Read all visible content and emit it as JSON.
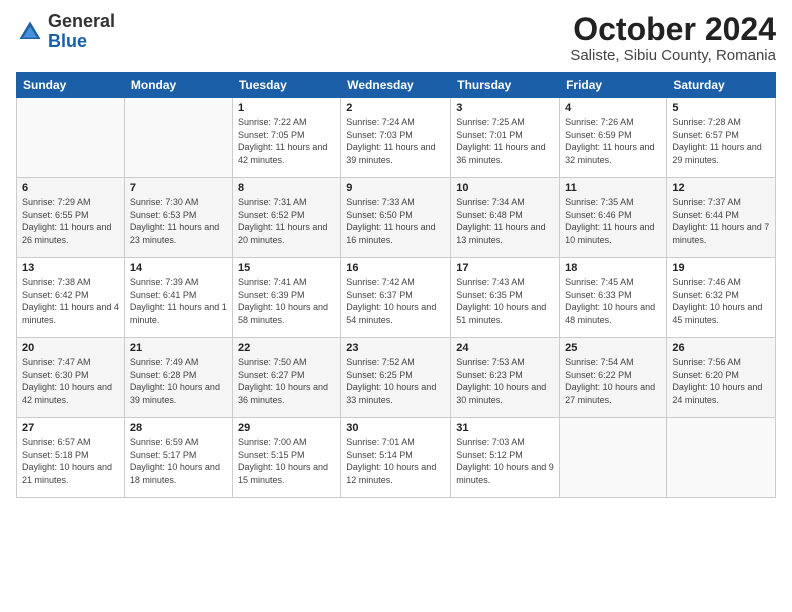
{
  "header": {
    "logo_general": "General",
    "logo_blue": "Blue",
    "month_title": "October 2024",
    "location": "Saliste, Sibiu County, Romania"
  },
  "days_of_week": [
    "Sunday",
    "Monday",
    "Tuesday",
    "Wednesday",
    "Thursday",
    "Friday",
    "Saturday"
  ],
  "weeks": [
    [
      {
        "day": "",
        "info": ""
      },
      {
        "day": "",
        "info": ""
      },
      {
        "day": "1",
        "info": "Sunrise: 7:22 AM\nSunset: 7:05 PM\nDaylight: 11 hours\nand 42 minutes."
      },
      {
        "day": "2",
        "info": "Sunrise: 7:24 AM\nSunset: 7:03 PM\nDaylight: 11 hours\nand 39 minutes."
      },
      {
        "day": "3",
        "info": "Sunrise: 7:25 AM\nSunset: 7:01 PM\nDaylight: 11 hours\nand 36 minutes."
      },
      {
        "day": "4",
        "info": "Sunrise: 7:26 AM\nSunset: 6:59 PM\nDaylight: 11 hours\nand 32 minutes."
      },
      {
        "day": "5",
        "info": "Sunrise: 7:28 AM\nSunset: 6:57 PM\nDaylight: 11 hours\nand 29 minutes."
      }
    ],
    [
      {
        "day": "6",
        "info": "Sunrise: 7:29 AM\nSunset: 6:55 PM\nDaylight: 11 hours\nand 26 minutes."
      },
      {
        "day": "7",
        "info": "Sunrise: 7:30 AM\nSunset: 6:53 PM\nDaylight: 11 hours\nand 23 minutes."
      },
      {
        "day": "8",
        "info": "Sunrise: 7:31 AM\nSunset: 6:52 PM\nDaylight: 11 hours\nand 20 minutes."
      },
      {
        "day": "9",
        "info": "Sunrise: 7:33 AM\nSunset: 6:50 PM\nDaylight: 11 hours\nand 16 minutes."
      },
      {
        "day": "10",
        "info": "Sunrise: 7:34 AM\nSunset: 6:48 PM\nDaylight: 11 hours\nand 13 minutes."
      },
      {
        "day": "11",
        "info": "Sunrise: 7:35 AM\nSunset: 6:46 PM\nDaylight: 11 hours\nand 10 minutes."
      },
      {
        "day": "12",
        "info": "Sunrise: 7:37 AM\nSunset: 6:44 PM\nDaylight: 11 hours\nand 7 minutes."
      }
    ],
    [
      {
        "day": "13",
        "info": "Sunrise: 7:38 AM\nSunset: 6:42 PM\nDaylight: 11 hours\nand 4 minutes."
      },
      {
        "day": "14",
        "info": "Sunrise: 7:39 AM\nSunset: 6:41 PM\nDaylight: 11 hours\nand 1 minute."
      },
      {
        "day": "15",
        "info": "Sunrise: 7:41 AM\nSunset: 6:39 PM\nDaylight: 10 hours\nand 58 minutes."
      },
      {
        "day": "16",
        "info": "Sunrise: 7:42 AM\nSunset: 6:37 PM\nDaylight: 10 hours\nand 54 minutes."
      },
      {
        "day": "17",
        "info": "Sunrise: 7:43 AM\nSunset: 6:35 PM\nDaylight: 10 hours\nand 51 minutes."
      },
      {
        "day": "18",
        "info": "Sunrise: 7:45 AM\nSunset: 6:33 PM\nDaylight: 10 hours\nand 48 minutes."
      },
      {
        "day": "19",
        "info": "Sunrise: 7:46 AM\nSunset: 6:32 PM\nDaylight: 10 hours\nand 45 minutes."
      }
    ],
    [
      {
        "day": "20",
        "info": "Sunrise: 7:47 AM\nSunset: 6:30 PM\nDaylight: 10 hours\nand 42 minutes."
      },
      {
        "day": "21",
        "info": "Sunrise: 7:49 AM\nSunset: 6:28 PM\nDaylight: 10 hours\nand 39 minutes."
      },
      {
        "day": "22",
        "info": "Sunrise: 7:50 AM\nSunset: 6:27 PM\nDaylight: 10 hours\nand 36 minutes."
      },
      {
        "day": "23",
        "info": "Sunrise: 7:52 AM\nSunset: 6:25 PM\nDaylight: 10 hours\nand 33 minutes."
      },
      {
        "day": "24",
        "info": "Sunrise: 7:53 AM\nSunset: 6:23 PM\nDaylight: 10 hours\nand 30 minutes."
      },
      {
        "day": "25",
        "info": "Sunrise: 7:54 AM\nSunset: 6:22 PM\nDaylight: 10 hours\nand 27 minutes."
      },
      {
        "day": "26",
        "info": "Sunrise: 7:56 AM\nSunset: 6:20 PM\nDaylight: 10 hours\nand 24 minutes."
      }
    ],
    [
      {
        "day": "27",
        "info": "Sunrise: 6:57 AM\nSunset: 5:18 PM\nDaylight: 10 hours\nand 21 minutes."
      },
      {
        "day": "28",
        "info": "Sunrise: 6:59 AM\nSunset: 5:17 PM\nDaylight: 10 hours\nand 18 minutes."
      },
      {
        "day": "29",
        "info": "Sunrise: 7:00 AM\nSunset: 5:15 PM\nDaylight: 10 hours\nand 15 minutes."
      },
      {
        "day": "30",
        "info": "Sunrise: 7:01 AM\nSunset: 5:14 PM\nDaylight: 10 hours\nand 12 minutes."
      },
      {
        "day": "31",
        "info": "Sunrise: 7:03 AM\nSunset: 5:12 PM\nDaylight: 10 hours\nand 9 minutes."
      },
      {
        "day": "",
        "info": ""
      },
      {
        "day": "",
        "info": ""
      }
    ]
  ]
}
